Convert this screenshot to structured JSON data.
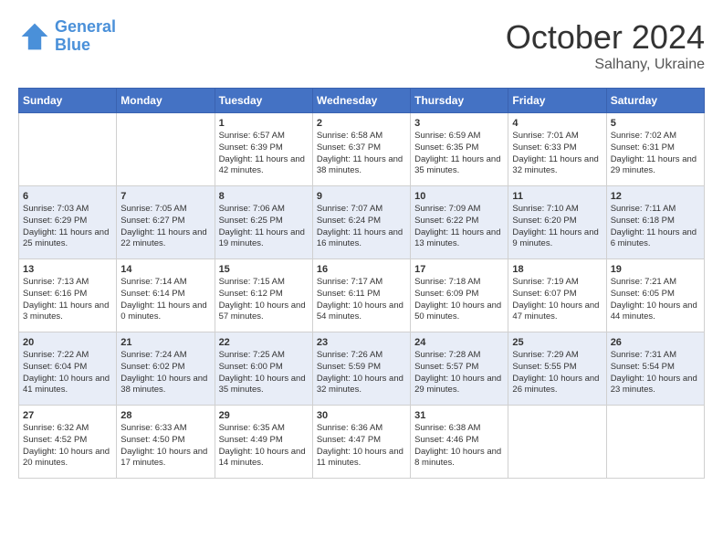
{
  "header": {
    "logo_line1": "General",
    "logo_line2": "Blue",
    "month": "October 2024",
    "location": "Salhany, Ukraine"
  },
  "weekdays": [
    "Sunday",
    "Monday",
    "Tuesday",
    "Wednesday",
    "Thursday",
    "Friday",
    "Saturday"
  ],
  "weeks": [
    [
      null,
      null,
      {
        "day": 1,
        "sunrise": "6:57 AM",
        "sunset": "6:39 PM",
        "daylight": "11 hours and 42 minutes."
      },
      {
        "day": 2,
        "sunrise": "6:58 AM",
        "sunset": "6:37 PM",
        "daylight": "11 hours and 38 minutes."
      },
      {
        "day": 3,
        "sunrise": "6:59 AM",
        "sunset": "6:35 PM",
        "daylight": "11 hours and 35 minutes."
      },
      {
        "day": 4,
        "sunrise": "7:01 AM",
        "sunset": "6:33 PM",
        "daylight": "11 hours and 32 minutes."
      },
      {
        "day": 5,
        "sunrise": "7:02 AM",
        "sunset": "6:31 PM",
        "daylight": "11 hours and 29 minutes."
      }
    ],
    [
      {
        "day": 6,
        "sunrise": "7:03 AM",
        "sunset": "6:29 PM",
        "daylight": "11 hours and 25 minutes."
      },
      {
        "day": 7,
        "sunrise": "7:05 AM",
        "sunset": "6:27 PM",
        "daylight": "11 hours and 22 minutes."
      },
      {
        "day": 8,
        "sunrise": "7:06 AM",
        "sunset": "6:25 PM",
        "daylight": "11 hours and 19 minutes."
      },
      {
        "day": 9,
        "sunrise": "7:07 AM",
        "sunset": "6:24 PM",
        "daylight": "11 hours and 16 minutes."
      },
      {
        "day": 10,
        "sunrise": "7:09 AM",
        "sunset": "6:22 PM",
        "daylight": "11 hours and 13 minutes."
      },
      {
        "day": 11,
        "sunrise": "7:10 AM",
        "sunset": "6:20 PM",
        "daylight": "11 hours and 9 minutes."
      },
      {
        "day": 12,
        "sunrise": "7:11 AM",
        "sunset": "6:18 PM",
        "daylight": "11 hours and 6 minutes."
      }
    ],
    [
      {
        "day": 13,
        "sunrise": "7:13 AM",
        "sunset": "6:16 PM",
        "daylight": "11 hours and 3 minutes."
      },
      {
        "day": 14,
        "sunrise": "7:14 AM",
        "sunset": "6:14 PM",
        "daylight": "11 hours and 0 minutes."
      },
      {
        "day": 15,
        "sunrise": "7:15 AM",
        "sunset": "6:12 PM",
        "daylight": "10 hours and 57 minutes."
      },
      {
        "day": 16,
        "sunrise": "7:17 AM",
        "sunset": "6:11 PM",
        "daylight": "10 hours and 54 minutes."
      },
      {
        "day": 17,
        "sunrise": "7:18 AM",
        "sunset": "6:09 PM",
        "daylight": "10 hours and 50 minutes."
      },
      {
        "day": 18,
        "sunrise": "7:19 AM",
        "sunset": "6:07 PM",
        "daylight": "10 hours and 47 minutes."
      },
      {
        "day": 19,
        "sunrise": "7:21 AM",
        "sunset": "6:05 PM",
        "daylight": "10 hours and 44 minutes."
      }
    ],
    [
      {
        "day": 20,
        "sunrise": "7:22 AM",
        "sunset": "6:04 PM",
        "daylight": "10 hours and 41 minutes."
      },
      {
        "day": 21,
        "sunrise": "7:24 AM",
        "sunset": "6:02 PM",
        "daylight": "10 hours and 38 minutes."
      },
      {
        "day": 22,
        "sunrise": "7:25 AM",
        "sunset": "6:00 PM",
        "daylight": "10 hours and 35 minutes."
      },
      {
        "day": 23,
        "sunrise": "7:26 AM",
        "sunset": "5:59 PM",
        "daylight": "10 hours and 32 minutes."
      },
      {
        "day": 24,
        "sunrise": "7:28 AM",
        "sunset": "5:57 PM",
        "daylight": "10 hours and 29 minutes."
      },
      {
        "day": 25,
        "sunrise": "7:29 AM",
        "sunset": "5:55 PM",
        "daylight": "10 hours and 26 minutes."
      },
      {
        "day": 26,
        "sunrise": "7:31 AM",
        "sunset": "5:54 PM",
        "daylight": "10 hours and 23 minutes."
      }
    ],
    [
      {
        "day": 27,
        "sunrise": "6:32 AM",
        "sunset": "4:52 PM",
        "daylight": "10 hours and 20 minutes."
      },
      {
        "day": 28,
        "sunrise": "6:33 AM",
        "sunset": "4:50 PM",
        "daylight": "10 hours and 17 minutes."
      },
      {
        "day": 29,
        "sunrise": "6:35 AM",
        "sunset": "4:49 PM",
        "daylight": "10 hours and 14 minutes."
      },
      {
        "day": 30,
        "sunrise": "6:36 AM",
        "sunset": "4:47 PM",
        "daylight": "10 hours and 11 minutes."
      },
      {
        "day": 31,
        "sunrise": "6:38 AM",
        "sunset": "4:46 PM",
        "daylight": "10 hours and 8 minutes."
      },
      null,
      null
    ]
  ]
}
